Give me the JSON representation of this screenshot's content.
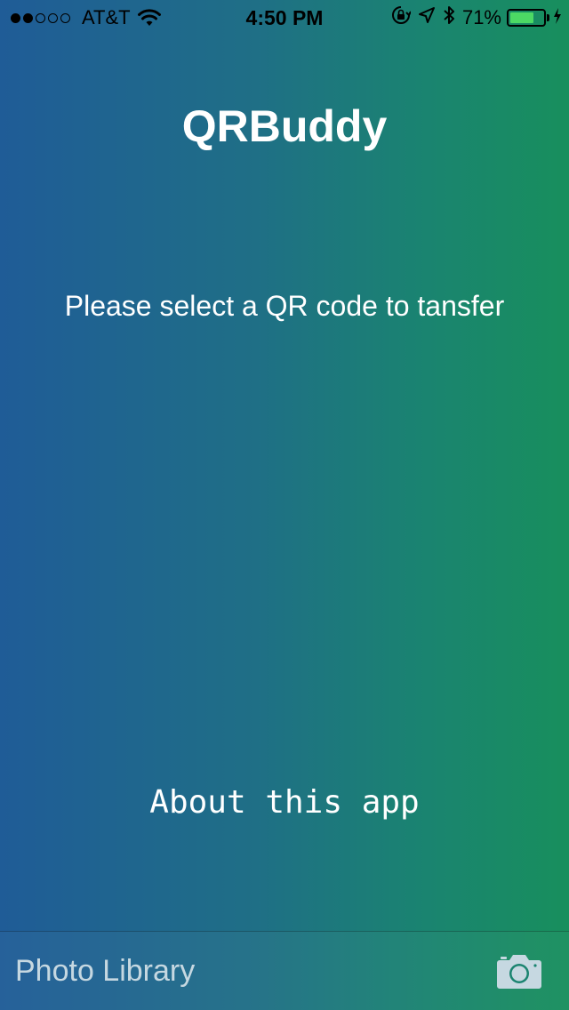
{
  "status_bar": {
    "carrier": "AT&T",
    "signal_bars_filled": 2,
    "signal_bars_total": 5,
    "time": "4:50 PM",
    "battery_percent_text": "71%",
    "battery_level": 0.71,
    "icons": [
      "wifi-icon",
      "orientation-lock-icon",
      "location-arrow-icon",
      "bluetooth-icon",
      "battery-icon",
      "charging-bolt-icon"
    ]
  },
  "main": {
    "title": "QRBuddy",
    "prompt": "Please select a QR code to tansfer",
    "about_label": "About this app"
  },
  "toolbar": {
    "photo_library_label": "Photo Library",
    "camera_icon": "camera-icon"
  },
  "colors": {
    "gradient_start": "#1f5c97",
    "gradient_end": "#188f5d",
    "battery_fill": "#4cd964",
    "toolbar_text": "#c6d8e1"
  }
}
